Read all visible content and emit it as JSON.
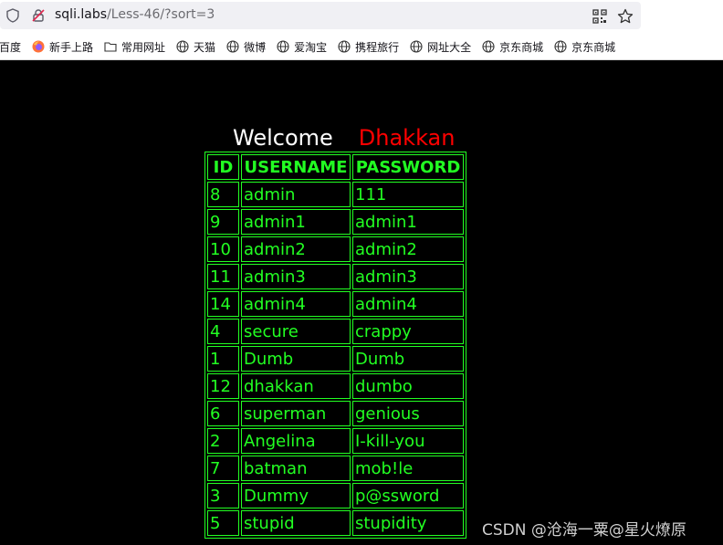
{
  "browser": {
    "url_host": "sqli.labs",
    "url_path": "/Less-46/?sort=3"
  },
  "bookmarks": [
    {
      "label": "百度",
      "icon": "none"
    },
    {
      "label": "新手上路",
      "icon": "firefox-icon"
    },
    {
      "label": "常用网址",
      "icon": "folder-icon"
    },
    {
      "label": "天猫",
      "icon": "globe-icon"
    },
    {
      "label": "微博",
      "icon": "globe-icon"
    },
    {
      "label": "爱淘宝",
      "icon": "globe-icon"
    },
    {
      "label": "携程旅行",
      "icon": "globe-icon"
    },
    {
      "label": "网址大全",
      "icon": "globe-icon"
    },
    {
      "label": "京东商城",
      "icon": "globe-icon"
    },
    {
      "label": "京东商城",
      "icon": "globe-icon"
    }
  ],
  "page": {
    "welcome": "Welcome",
    "name": "Dhakkan",
    "headers": [
      "ID",
      "USERNAME",
      "PASSWORD"
    ],
    "rows": [
      [
        "8",
        "admin",
        "111"
      ],
      [
        "9",
        "admin1",
        "admin1"
      ],
      [
        "10",
        "admin2",
        "admin2"
      ],
      [
        "11",
        "admin3",
        "admin3"
      ],
      [
        "14",
        "admin4",
        "admin4"
      ],
      [
        "4",
        "secure",
        "crappy"
      ],
      [
        "1",
        "Dumb",
        "Dumb"
      ],
      [
        "12",
        "dhakkan",
        "dumbo"
      ],
      [
        "6",
        "superman",
        "genious"
      ],
      [
        "2",
        "Angelina",
        "I-kill-you"
      ],
      [
        "7",
        "batman",
        "mob!le"
      ],
      [
        "3",
        "Dummy",
        "p@ssword"
      ],
      [
        "5",
        "stupid",
        "stupidity"
      ]
    ]
  },
  "watermark": "CSDN @沧海一粟@星火燎原",
  "colors": {
    "table_green": "#22ff22",
    "name_red": "#ff0000",
    "background": "#000000"
  }
}
